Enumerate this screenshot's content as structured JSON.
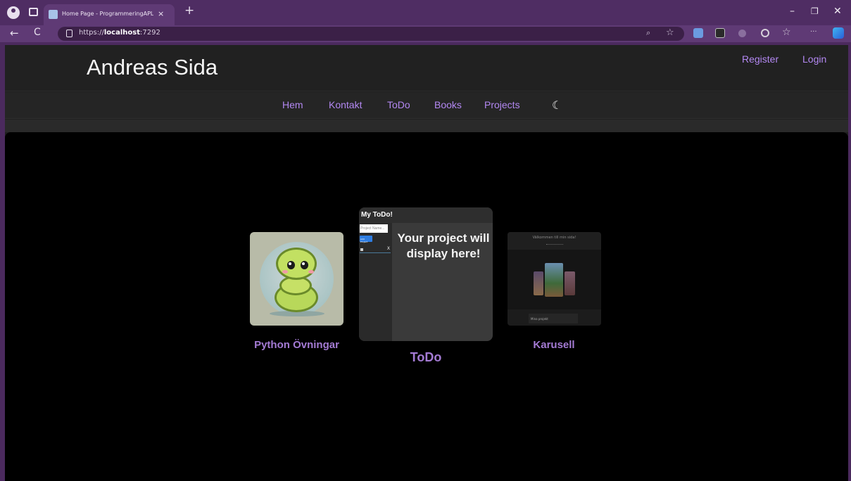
{
  "browser": {
    "tab_title": "Home Page - ProgrammeringAPL",
    "tab_close": "×",
    "new_tab": "+",
    "url_prefix": "https://",
    "url_host": "localhost",
    "url_port": ":7292",
    "window_minimize": "–",
    "window_restore": "❐",
    "window_close": "✕",
    "back": "←",
    "refresh": "C",
    "zoom_icon": "⌕",
    "favorite_icon": "☆",
    "favorites_icon": "☆",
    "more_icon": "···"
  },
  "site": {
    "brand": "Andreas Sida",
    "auth": {
      "register": "Register",
      "login": "Login"
    },
    "nav": [
      "Hem",
      "Kontakt",
      "ToDo",
      "Books",
      "Projects"
    ],
    "theme_toggle_icon": "moon-icon",
    "accent_color": "#b388f2"
  },
  "carousel": {
    "items": [
      {
        "label": "Python Övningar"
      },
      {
        "label": "ToDo",
        "preview": {
          "title": "My ToDo!",
          "input_placeholder": "Project Name...",
          "button": "Add Project",
          "item_delete": "X",
          "message": "Your project will display here!"
        }
      },
      {
        "label": "Karusell",
        "preview": {
          "welcome": "Välkommen till min sida!",
          "field": "Mina projekt"
        }
      }
    ]
  }
}
